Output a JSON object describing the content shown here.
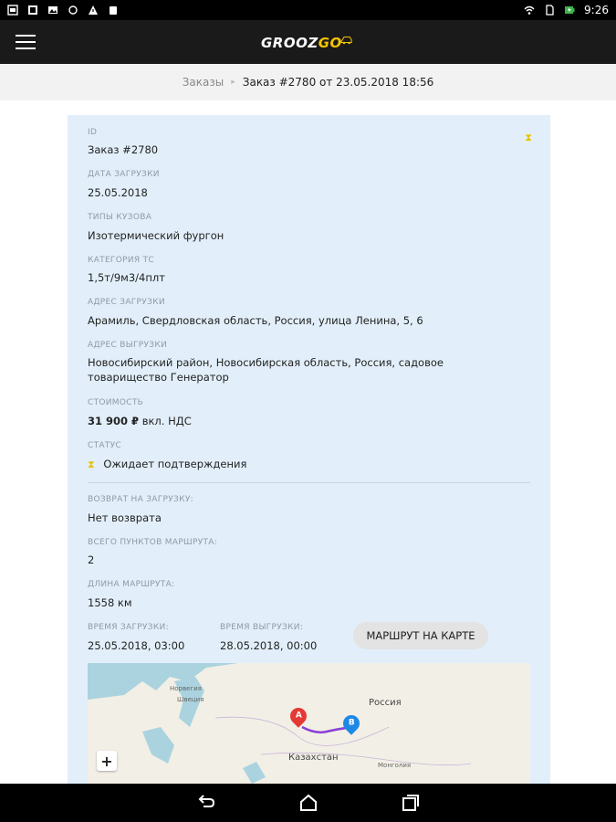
{
  "status_bar": {
    "time": "9:26"
  },
  "app": {
    "logo_main": "GROOZ",
    "logo_accent": "GO"
  },
  "breadcrumb": {
    "parent": "Заказы",
    "current": "Заказ #2780 от 23.05.2018 18:56"
  },
  "order": {
    "id_label": "ID",
    "id_value": "Заказ #2780",
    "load_date_label": "ДАТА ЗАГРУЗКИ",
    "load_date_value": "25.05.2018",
    "body_types_label": "ТИПЫ КУЗОВА",
    "body_types_value": "Изотермический фургон",
    "category_label": "КАТЕГОРИЯ ТС",
    "category_value": "1,5т/9м3/4плт",
    "load_address_label": "АДРЕС ЗАГРУЗКИ",
    "load_address_value": "Арамиль, Свердловская область, Россия, улица Ленина, 5, 6",
    "unload_address_label": "АДРЕС ВЫГРУЗКИ",
    "unload_address_value": "Новосибирский район, Новосибирская область, Россия, садовое товарищество Генератор",
    "cost_label": "СТОИМОСТЬ",
    "cost_amount": "31 900 ₽",
    "cost_suffix": "вкл. НДС",
    "status_label": "СТАТУС",
    "status_value": "Ожидает подтверждения",
    "return_label": "ВОЗВРАТ НА ЗАГРУЗКУ:",
    "return_value": "Нет возврата",
    "points_label": "ВСЕГО ПУНКТОВ МАРШРУТА:",
    "points_value": "2",
    "length_label": "ДЛИНА МАРШРУТА:",
    "length_value": "1558 км",
    "load_time_label": "ВРЕМЯ ЗАГРУЗКИ:",
    "load_time_value": "25.05.2018, 03:00",
    "unload_time_label": "ВРЕМЯ ВЫГРУЗКИ:",
    "unload_time_value": "28.05.2018, 00:00",
    "route_button": "МАРШРУТ НА КАРТЕ"
  },
  "map": {
    "labels": {
      "norway": "Норвегия",
      "sweden": "Швеция",
      "russia": "Россия",
      "kazakhstan": "Казахстан",
      "mongolia": "Монголия"
    },
    "marker_a": "A",
    "marker_b": "B",
    "zoom_in": "+"
  },
  "colors": {
    "card_bg": "#e2effa",
    "accent": "#f4c400",
    "route": "#8a3fd8",
    "marker_a": "#e53935",
    "marker_b": "#1e88e5"
  }
}
